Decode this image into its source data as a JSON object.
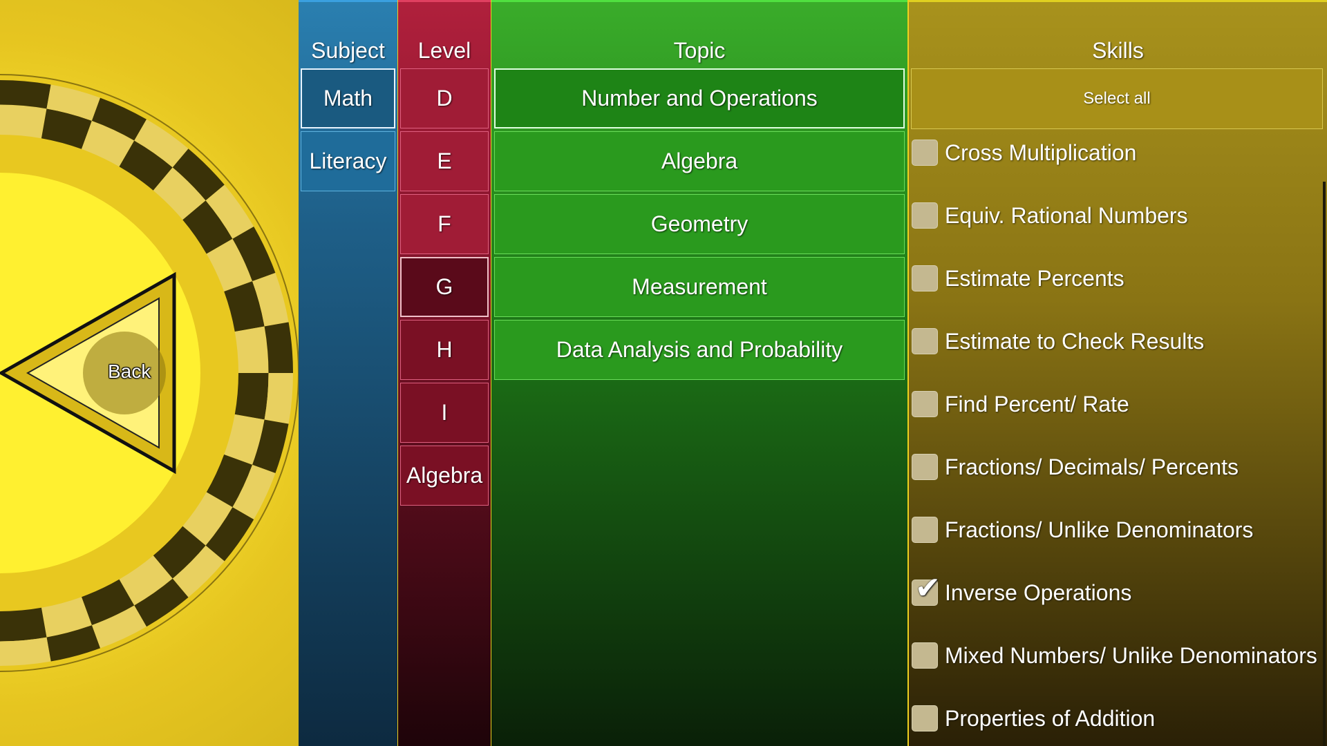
{
  "back": {
    "label": "Back"
  },
  "subject": {
    "header": "Subject",
    "items": [
      {
        "label": "Math",
        "selected": true
      },
      {
        "label": "Literacy",
        "selected": false
      }
    ]
  },
  "level": {
    "header": "Level",
    "items": [
      {
        "label": "D",
        "selected": false
      },
      {
        "label": "E",
        "selected": false
      },
      {
        "label": "F",
        "selected": false
      },
      {
        "label": "G",
        "selected": true
      },
      {
        "label": "H",
        "selected": false
      },
      {
        "label": "I",
        "selected": false
      },
      {
        "label": "Algebra",
        "selected": false
      }
    ]
  },
  "topic": {
    "header": "Topic",
    "items": [
      {
        "label": "Number and Operations",
        "selected": true
      },
      {
        "label": "Algebra",
        "selected": false
      },
      {
        "label": "Geometry",
        "selected": false
      },
      {
        "label": "Measurement",
        "selected": false
      },
      {
        "label": "Data Analysis and Probability",
        "selected": false
      }
    ]
  },
  "skills": {
    "header": "Skills",
    "select_all": "Select all",
    "items": [
      {
        "label": "Cross Multiplication",
        "checked": false
      },
      {
        "label": "Equiv. Rational Numbers",
        "checked": false
      },
      {
        "label": "Estimate Percents",
        "checked": false
      },
      {
        "label": "Estimate to Check Results",
        "checked": false
      },
      {
        "label": "Find Percent/ Rate",
        "checked": false
      },
      {
        "label": "Fractions/ Decimals/ Percents",
        "checked": false
      },
      {
        "label": "Fractions/ Unlike Denominators",
        "checked": false
      },
      {
        "label": "Inverse Operations",
        "checked": true
      },
      {
        "label": "Mixed Numbers/ Unlike Denominators",
        "checked": false
      },
      {
        "label": "Properties of Addition",
        "checked": false
      }
    ]
  },
  "colors": {
    "subject": "#1f6c9a",
    "level": "#a01c36",
    "topic": "#2a9a1e",
    "skills": "#a89018",
    "wheel": "#f6e030"
  }
}
